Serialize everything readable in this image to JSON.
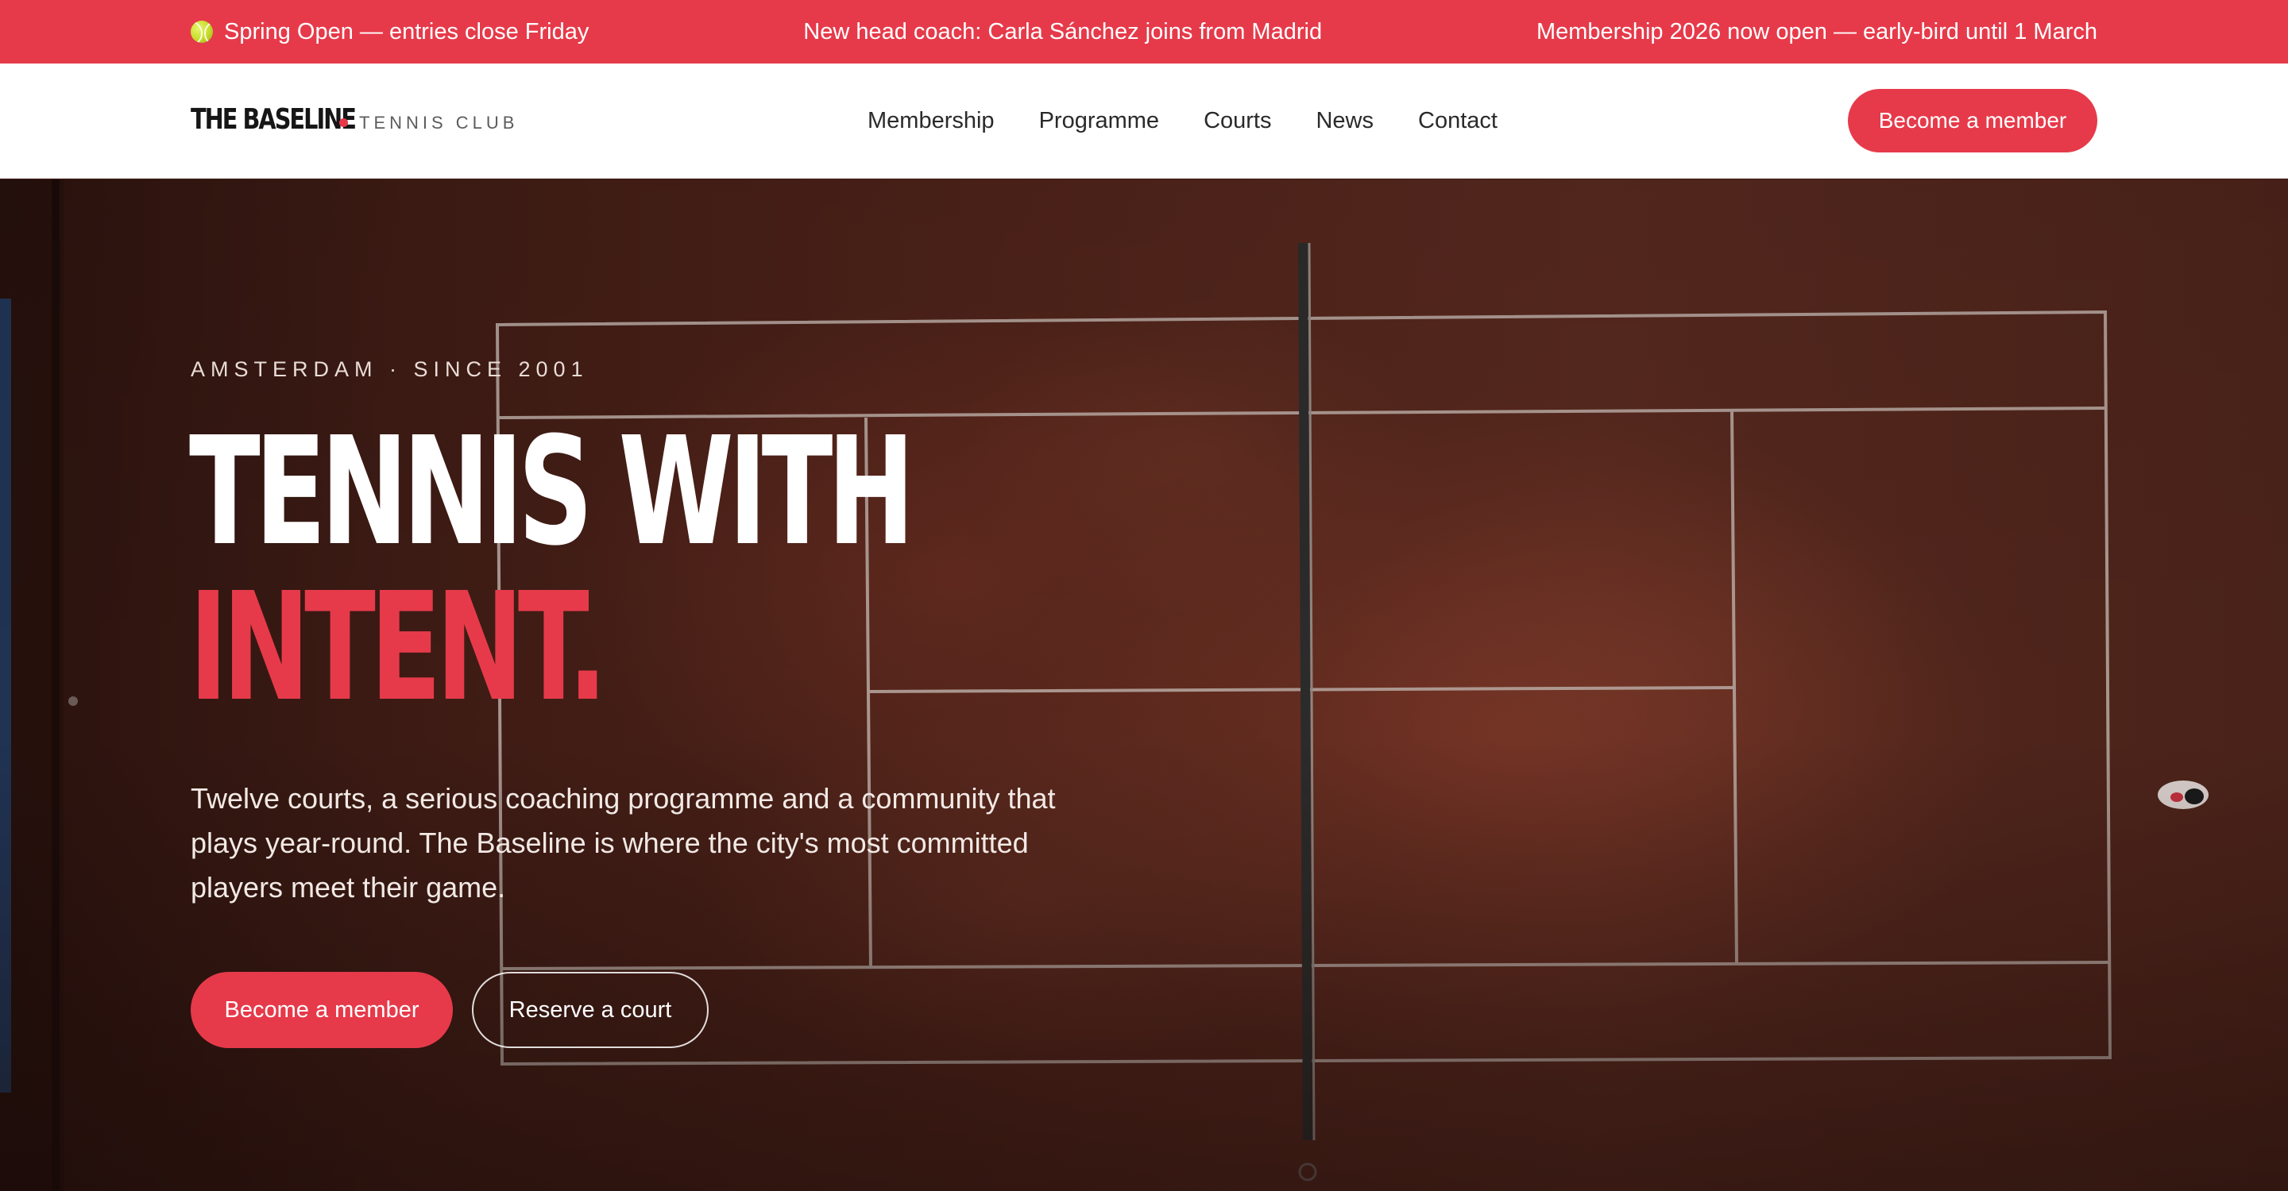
{
  "announcements": [
    {
      "icon": "tennis-ball-icon",
      "text": "Spring Open — entries close Friday"
    },
    {
      "text": "New head coach: Carla Sánchez joins from Madrid"
    },
    {
      "text": "Membership 2026 now open — early-bird until 1 March"
    }
  ],
  "brand": {
    "name": "THE BASELINE",
    "subtitle": "TENNIS CLUB"
  },
  "nav": {
    "items": [
      "Membership",
      "Programme",
      "Courts",
      "News",
      "Contact"
    ]
  },
  "header_cta": "Become a member",
  "hero": {
    "eyebrow": "AMSTERDAM · SINCE 2001",
    "headline_line1": "TENNIS WITH",
    "headline_line2": "INTENT.",
    "lede": "Twelve courts, a serious coaching programme and a community that plays year-round. The Baseline is where the city's most committed players meet their game.",
    "primary_button": "Become a member",
    "secondary_button": "Reserve a court"
  },
  "colors": {
    "accent": "#e63a4a",
    "clay": "#4d2219",
    "white": "#ffffff"
  }
}
